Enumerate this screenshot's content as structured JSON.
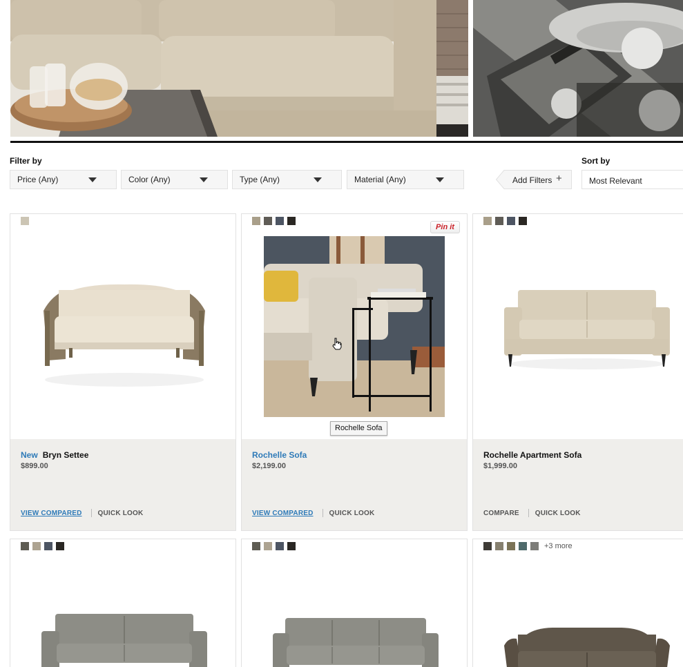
{
  "filters": {
    "filter_label": "Filter by",
    "dropdowns": [
      "Price (Any)",
      "Color (Any)",
      "Type (Any)",
      "Material (Any)"
    ],
    "add_filters": "Add Filters",
    "sort_label": "Sort by",
    "sort_value": "Most Relevant"
  },
  "products": [
    {
      "badge": "New",
      "name": "Bryn Settee",
      "price": "$899.00",
      "action1": "VIEW COMPARED",
      "action2": "QUICK LOOK",
      "swatches": [
        "#ccc5b4"
      ]
    },
    {
      "name": "Rochelle Sofa",
      "price": "$2,199.00",
      "action1": "VIEW COMPARED",
      "action2": "QUICK LOOK",
      "pin_label": "Pin it",
      "tooltip": "Rochelle Sofa",
      "swatches": [
        "#a99f8a",
        "#5f5c56",
        "#4d5563",
        "#2a2723"
      ]
    },
    {
      "name": "Rochelle Apartment Sofa",
      "price": "$1,999.00",
      "action1": "COMPARE",
      "action2": "QUICK LOOK",
      "swatches": [
        "#a99f8a",
        "#5f5c56",
        "#4d5563",
        "#2a2723"
      ]
    },
    {
      "swatches": [
        "#5e5c53",
        "#ada391",
        "#4d5563",
        "#2a2723"
      ]
    },
    {
      "swatches": [
        "#5e5c53",
        "#ada391",
        "#4d5563",
        "#2a2723"
      ]
    },
    {
      "swatches": [
        "#3e3b36",
        "#86806f",
        "#7b7357",
        "#4f6a6b",
        "#7d7d79"
      ],
      "more": "+3 more"
    }
  ],
  "colors": {
    "link_blue": "#2e7ab8",
    "info_panel": "#efeeeb",
    "pin_red": "#cb2027"
  }
}
